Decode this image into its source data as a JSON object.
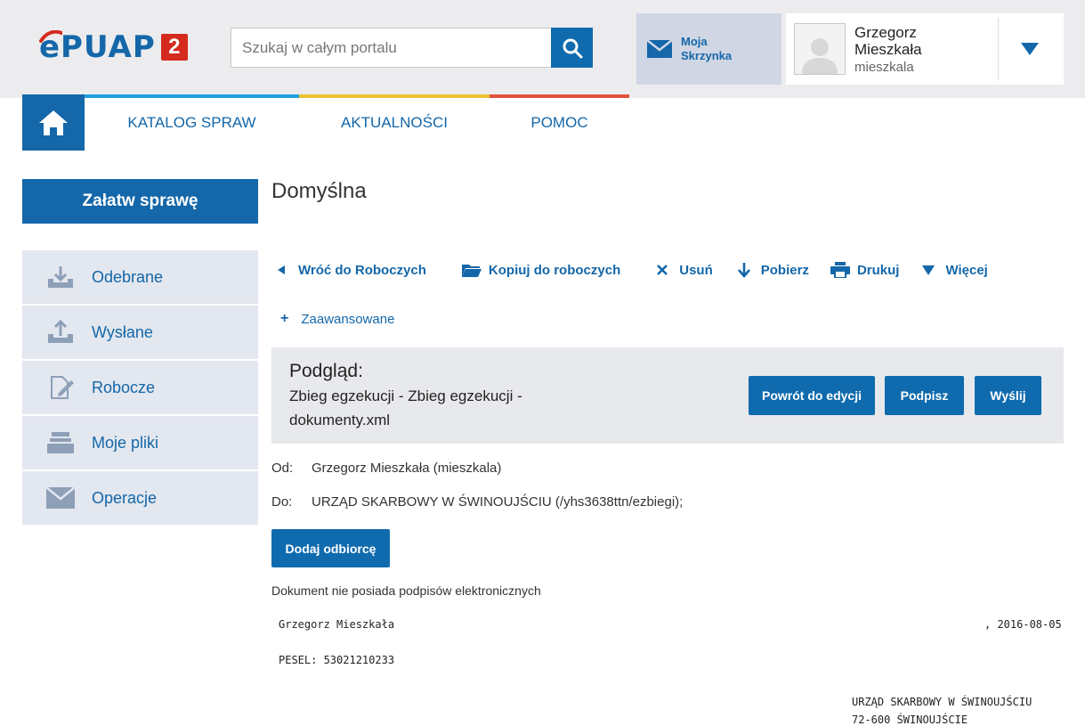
{
  "header": {
    "logo_text": "ePUAP",
    "logo_badge": "2",
    "search_placeholder": "Szukaj w całym portalu",
    "mailbox_label": "Moja Skrzynka",
    "user_name": "Grzegorz Mieszkała",
    "user_login": "mieszkala"
  },
  "nav": {
    "items": [
      {
        "label": "KATALOG SPRAW",
        "color": "#1e9ee0"
      },
      {
        "label": "AKTUALNOŚCI",
        "color": "#e9c12c"
      },
      {
        "label": "POMOC",
        "color": "#e3513c"
      }
    ]
  },
  "sidebar": {
    "cta": "Załatw sprawę",
    "items": [
      {
        "label": "Odebrane",
        "icon": "inbox-download-icon"
      },
      {
        "label": "Wysłane",
        "icon": "outbox-upload-icon"
      },
      {
        "label": "Robocze",
        "icon": "draft-edit-icon"
      },
      {
        "label": "Moje pliki",
        "icon": "files-tray-icon"
      },
      {
        "label": "Operacje",
        "icon": "envelope-icon"
      }
    ]
  },
  "main": {
    "title": "Domyślna",
    "toolbar": {
      "back": "Wróć do Roboczych",
      "copy": "Kopiuj do roboczych",
      "delete": "Usuń",
      "download": "Pobierz",
      "print": "Drukuj",
      "more": "Więcej"
    },
    "advanced": "Zaawansowane",
    "preview": {
      "title": "Podgląd:",
      "subtitle": "Zbieg egzekucji - Zbieg egzekucji - dokumenty.xml",
      "btn_edit": "Powrót do edycji",
      "btn_sign": "Podpisz",
      "btn_send": "Wyślij"
    },
    "from_label": "Od:",
    "from_value": "Grzegorz Mieszkała (mieszkala)",
    "to_label": "Do:",
    "to_value": "URZĄD SKARBOWY W ŚWINOUJŚCIU (/yhs3638ttn/ezbiegi);",
    "add_recipient": "Dodaj odbiorcę",
    "signature_note": "Dokument nie posiada podpisów elektronicznych",
    "document": {
      "sender_name": "Grzegorz Mieszkała",
      "date": ", 2016-08-05",
      "pesel": "PESEL: 53021210233",
      "recipient_line1": "URZĄD SKARBOWY W ŚWINOUJŚCIU",
      "recipient_line2": "72-600 ŚWINOUJŚCIE"
    }
  }
}
